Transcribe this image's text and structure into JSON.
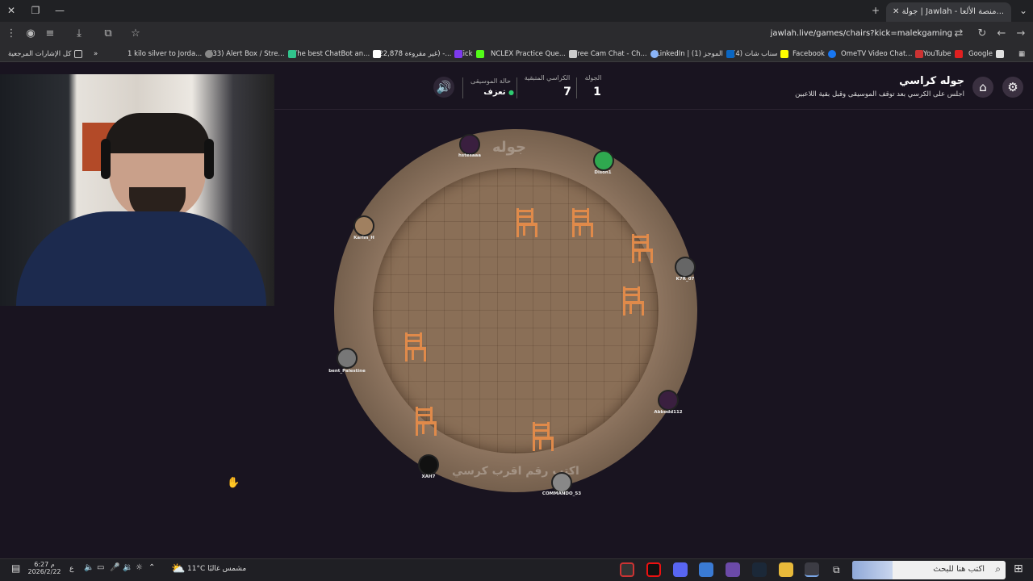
{
  "browser": {
    "tab_title": "جولة | Jawlah - منصة الألعا...",
    "url": "jawlah.live/games/chairs?kick=malekgaming",
    "bookmarks": [
      "Google",
      "YouTube",
      "OmeTV Video Chat...",
      "Facebook",
      "(4) سناب شات",
      "LinkedIn | (1) الموجز",
      "Free Cam Chat - Ch...",
      "NCLEX Practice Que...",
      "Kick",
      "(22,878 غير مقروءة) -...",
      "The best ChatBot an...",
      "(33) Alert Box / Stre...",
      "1 kilo silver to Jorda...",
      "كل الإشارات المرجعية"
    ]
  },
  "game": {
    "title": "جوله كراسي",
    "subtitle": "اجلس على الكرسي بعد توقف الموسيقى وقبل بقية اللاعبين",
    "round_label": "الجولة",
    "round_value": "1",
    "chairs_label": "الكراسي المتبقية",
    "chairs_value": "7",
    "music_label": "حالة الموسيقى",
    "music_value": "تعزف",
    "watermark_top": "جوله",
    "watermark_bottom": "اكتب رقم اقرب كرسي"
  },
  "players": [
    "hstesaaa",
    "Dison1",
    "Karim_H",
    "K7R_07",
    "bent_Palestine",
    "Abbodd112",
    "XAH7",
    "COMMANDO_53"
  ],
  "taskbar": {
    "search_placeholder": "اكتب هنا للبحث",
    "weather": "11°C  مشمس غالبًا",
    "time": "6:27 م",
    "date": "2026/2/22",
    "lang": "ع"
  },
  "colors": {
    "accent": "#2ecc71",
    "board": "#8e7560",
    "chair": "#e08a4a"
  }
}
